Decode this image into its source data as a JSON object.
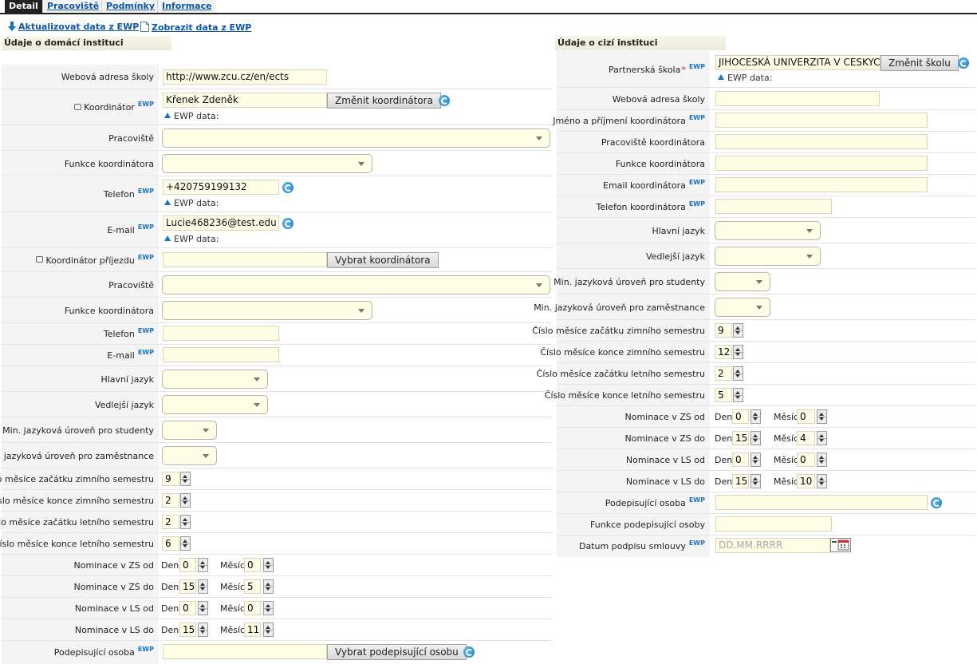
{
  "tabs": [
    {
      "label": "Detail",
      "active": true
    },
    {
      "label": "Pracoviště",
      "active": false
    },
    {
      "label": "Podmínky",
      "active": false
    },
    {
      "label": "Informace",
      "active": false
    }
  ],
  "actions": {
    "update": "Aktualizovat data z EWP",
    "show": "Zobrazit data z EWP"
  },
  "ewp_badge": "EWP",
  "ewp_data_label": "EWP data:",
  "day_label": "Den",
  "month_label": "Měsíc",
  "home": {
    "title": "Údaje o domácí instituci",
    "web_label": "Webová adresa školy",
    "web_value": "http://www.zcu.cz/en/ects",
    "coord_label": "Koordinátor",
    "coord_value": "Křenek Zdeněk",
    "coord_button": "Změnit koordinátora",
    "workplace_label": "Pracoviště",
    "function_label": "Funkce koordinátora",
    "phone_label": "Telefon",
    "phone_value": "+420759199132",
    "email_label": "E-mail",
    "email_value": "Lucie468236@test.edu",
    "arrival_label": "Koordinátor příjezdu",
    "arrival_button": "Vybrat koordinátora",
    "arr_workplace_label": "Pracoviště",
    "arr_function_label": "Funkce koordinátora",
    "arr_phone_label": "Telefon",
    "arr_email_label": "E-mail",
    "main_lang_label": "Hlavní jazyk",
    "second_lang_label": "Vedlejší jazyk",
    "min_students_label": "Min. jazyková úroveň pro studenty",
    "min_staff_label": "Min. jazyková úroveň pro zaměstnance",
    "winter_start_label": "Číslo měsíce začátku zimního semestru",
    "winter_start": "9",
    "winter_end_label": "Číslo měsíce konce zimního semestru",
    "winter_end": "2",
    "summer_start_label": "Číslo měsíce začátku letního semestru",
    "summer_start": "2",
    "summer_end_label": "Číslo měsíce konce letního semestru",
    "summer_end": "6",
    "zs_from_label": "Nominace v ZS od",
    "zs_from_day": "0",
    "zs_from_month": "0",
    "zs_to_label": "Nominace v ZS do",
    "zs_to_day": "15",
    "zs_to_month": "5",
    "ls_from_label": "Nominace v LS od",
    "ls_from_day": "0",
    "ls_from_month": "0",
    "ls_to_label": "Nominace v LS do",
    "ls_to_day": "15",
    "ls_to_month": "11",
    "signer_label": "Podepisující osoba",
    "signer_button": "Vybrat podepisující osobu"
  },
  "foreign": {
    "title": "Údaje o cizí instituci",
    "school_label": "Partnerská škola",
    "school_required": "*",
    "school_value": "JIHOCESKÁ UNIVERZITA V CESKYCH",
    "school_button": "Změnit školu",
    "web_label": "Webová adresa školy",
    "coord_name_label": "Jméno a příjmení koordinátora",
    "coord_workplace_label": "Pracoviště koordinátora",
    "coord_function_label": "Funkce koordinátora",
    "coord_email_label": "Email koordinátora",
    "coord_phone_label": "Telefon koordinátora",
    "main_lang_label": "Hlavní jazyk",
    "second_lang_label": "Vedlejší jazyk",
    "min_students_label": "Min. jazyková úroveň pro studenty",
    "min_staff_label": "Min. jazyková úroveň pro zaměstnance",
    "winter_start_label": "Číslo měsíce začátku zimního semestru",
    "winter_start": "9",
    "winter_end_label": "Číslo měsíce konce zimního semestru",
    "winter_end": "12",
    "summer_start_label": "Číslo měsíce začátku letního semestru",
    "summer_start": "2",
    "summer_end_label": "Číslo měsíce konce letního semestru",
    "summer_end": "5",
    "zs_from_label": "Nominace v ZS od",
    "zs_from_day": "0",
    "zs_from_month": "0",
    "zs_to_label": "Nominace v ZS do",
    "zs_to_day": "15",
    "zs_to_month": "4",
    "ls_from_label": "Nominace v LS od",
    "ls_from_day": "0",
    "ls_from_month": "0",
    "ls_to_label": "Nominace v LS do",
    "ls_to_day": "15",
    "ls_to_month": "10",
    "signer_label": "Podepisující osoba",
    "signer_function_label": "Funkce podepisující osoby",
    "sign_date_label": "Datum podpisu smlouvy",
    "sign_date_placeholder": "DD.MM.RRRR"
  }
}
